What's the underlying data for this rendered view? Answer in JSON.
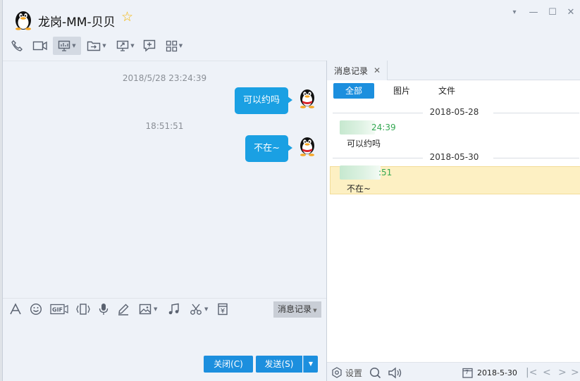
{
  "window": {
    "title": "龙岗-MM-贝贝",
    "controls": [
      "▾",
      "—",
      "☐",
      "✕"
    ]
  },
  "chat": {
    "messages": [
      {
        "timestamp": "2018/5/28 23:24:39",
        "text": "可以约吗"
      },
      {
        "timestamp": "18:51:51",
        "text": "不在~"
      }
    ]
  },
  "input": {
    "history_label": "消息记录"
  },
  "actions": {
    "close_label": "关闭(C)",
    "send_label": "发送(S)"
  },
  "history": {
    "tab_label": "消息记录",
    "filters": [
      "全部",
      "图片",
      "文件"
    ],
    "groups": [
      {
        "date": "2018-05-28",
        "time": "24:39",
        "text": "可以约吗"
      },
      {
        "date": "2018-05-30",
        "time": ":51",
        "text": "不在~"
      }
    ],
    "footer": {
      "settings_label": "设置",
      "date": "2018-5-30",
      "calendar_day": "7"
    }
  },
  "colors": {
    "accent": "#1c8fde",
    "bubble": "#1aa0e3",
    "highlight": "#fdf0c3",
    "time_green": "#33a852"
  }
}
